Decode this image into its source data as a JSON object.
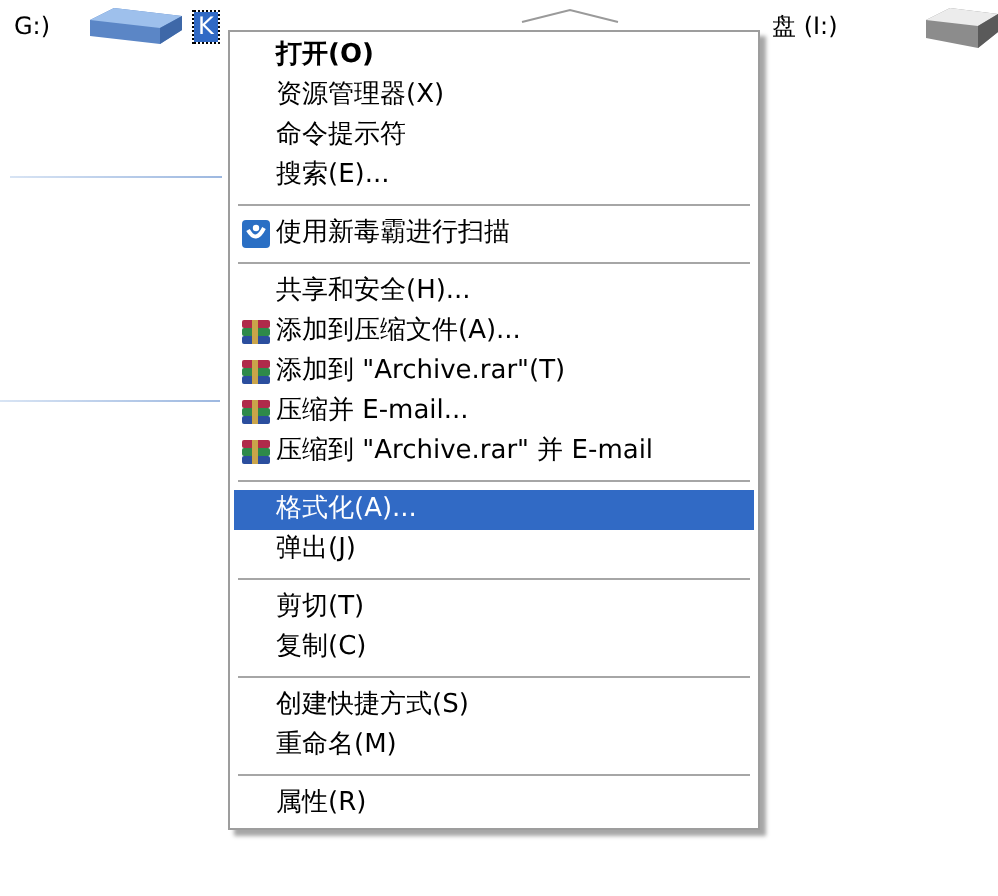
{
  "drives": [
    {
      "kind": "text",
      "label": "G:)",
      "selected": false
    },
    {
      "kind": "removable-drive"
    },
    {
      "kind": "text",
      "label": "K",
      "selected": true
    },
    {
      "kind": "hidden-drive"
    },
    {
      "kind": "text",
      "label": "盘 (I:)",
      "selected": false
    },
    {
      "kind": "hard-drive"
    }
  ],
  "context_menu": [
    {
      "kind": "item",
      "label": "打开(O)",
      "bold": true,
      "selected": false
    },
    {
      "kind": "item",
      "label": "资源管理器(X)",
      "bold": false,
      "selected": false
    },
    {
      "kind": "item",
      "label": "命令提示符",
      "bold": false,
      "selected": false
    },
    {
      "kind": "item",
      "label": "搜索(E)...",
      "bold": false,
      "selected": false
    },
    {
      "kind": "separator"
    },
    {
      "kind": "scan-item",
      "label": "使用新毒霸进行扫描",
      "bold": false,
      "selected": false
    },
    {
      "kind": "separator"
    },
    {
      "kind": "item",
      "label": "共享和安全(H)...",
      "bold": false,
      "selected": false
    },
    {
      "kind": "archive-item",
      "label": "添加到压缩文件(A)...",
      "bold": false,
      "selected": false
    },
    {
      "kind": "archive-item",
      "label": "添加到 \"Archive.rar\"(T)",
      "bold": false,
      "selected": false
    },
    {
      "kind": "archive-item",
      "label": "压缩并 E-mail...",
      "bold": false,
      "selected": false
    },
    {
      "kind": "archive-item",
      "label": "压缩到 \"Archive.rar\" 并 E-mail",
      "bold": false,
      "selected": false
    },
    {
      "kind": "separator"
    },
    {
      "kind": "item",
      "label": "格式化(A)...",
      "bold": false,
      "selected": true
    },
    {
      "kind": "item",
      "label": "弹出(J)",
      "bold": false,
      "selected": false
    },
    {
      "kind": "separator"
    },
    {
      "kind": "item",
      "label": "剪切(T)",
      "bold": false,
      "selected": false
    },
    {
      "kind": "item",
      "label": "复制(C)",
      "bold": false,
      "selected": false
    },
    {
      "kind": "separator"
    },
    {
      "kind": "item",
      "label": "创建快捷方式(S)",
      "bold": false,
      "selected": false
    },
    {
      "kind": "item",
      "label": "重命名(M)",
      "bold": false,
      "selected": false
    },
    {
      "kind": "separator"
    },
    {
      "kind": "item",
      "label": "属性(R)",
      "bold": false,
      "selected": false
    }
  ]
}
